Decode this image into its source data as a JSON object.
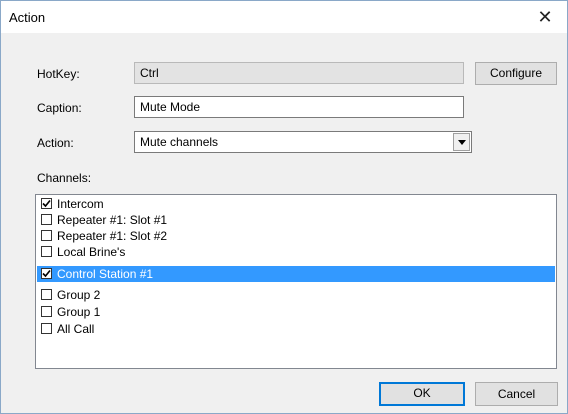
{
  "window": {
    "title": "Action",
    "close_glyph": "✕"
  },
  "form": {
    "hotkey_label": "HotKey:",
    "hotkey_value": "Ctrl",
    "configure_label": "Configure",
    "caption_label": "Caption:",
    "caption_value": "Mute Mode",
    "action_label": "Action:",
    "action_value": "Mute channels",
    "channels_label": "Channels:"
  },
  "channels": [
    {
      "label": "Intercom",
      "checked": true,
      "selected": false
    },
    {
      "label": "Repeater #1: Slot #1",
      "checked": false,
      "selected": false
    },
    {
      "label": "Repeater #1: Slot #2",
      "checked": false,
      "selected": false
    },
    {
      "label": "Local Brine's",
      "checked": false,
      "selected": false
    },
    {
      "label": "Control Station #1",
      "checked": true,
      "selected": true
    },
    {
      "label": "Group 2",
      "checked": false,
      "selected": false
    },
    {
      "label": "Group 1",
      "checked": false,
      "selected": false
    },
    {
      "label": "All Call",
      "checked": false,
      "selected": false
    }
  ],
  "buttons": {
    "ok_label": "OK",
    "cancel_label": "Cancel"
  },
  "icons": {
    "checkmark": "checkmark-icon",
    "dropdown": "chevron-down-icon",
    "close": "close-icon"
  },
  "colors": {
    "selection": "#3399ff",
    "default_button_border": "#0078d7"
  }
}
